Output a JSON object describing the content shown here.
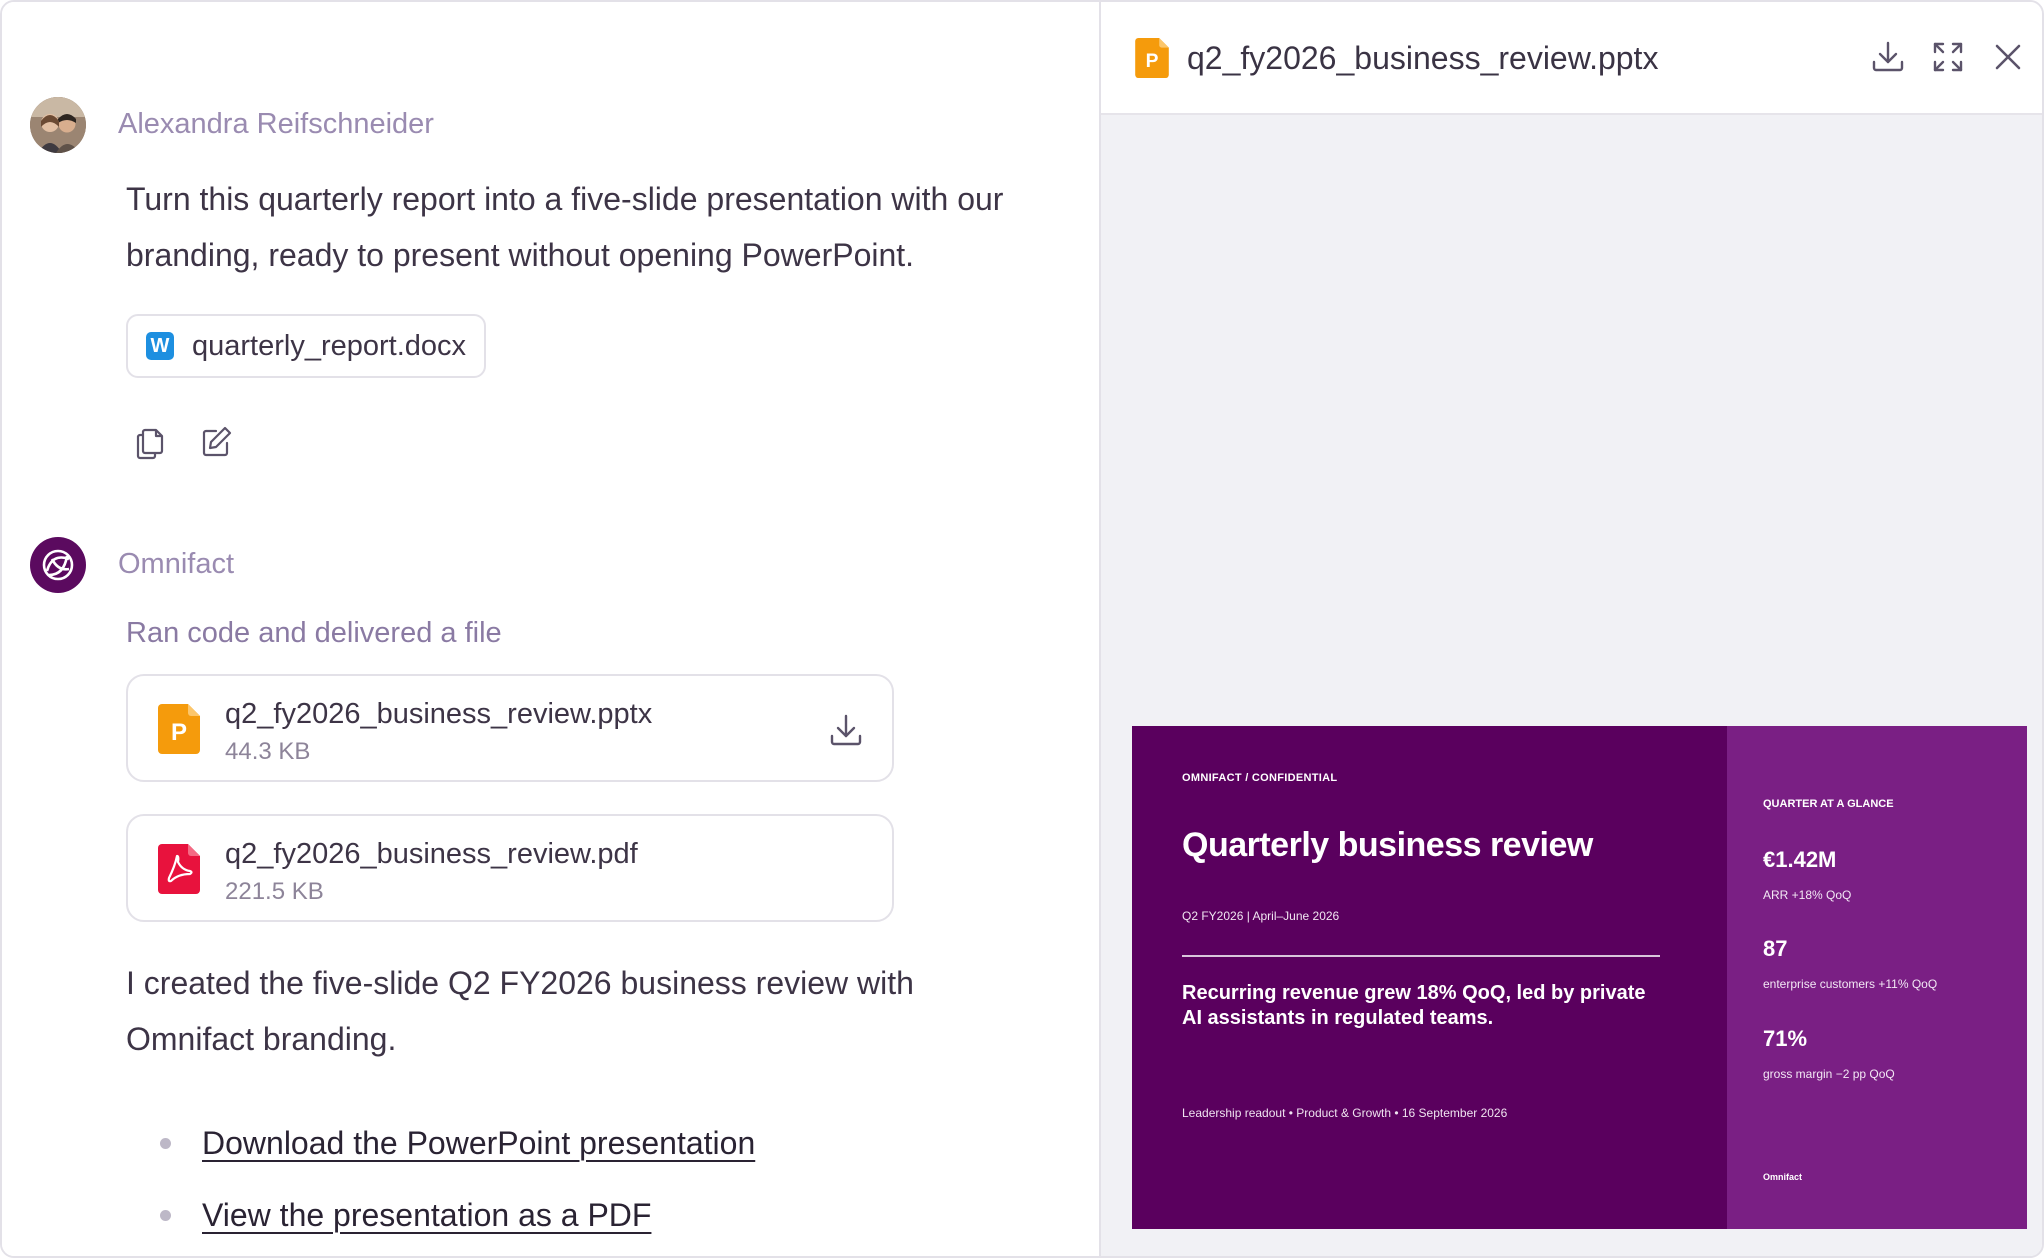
{
  "conversation": {
    "user": {
      "name": "Alexandra Reifschneider",
      "message": "Turn this quarterly report into a five-slide presentation with our branding, ready to present without opening PowerPoint.",
      "attachment": "quarterly_report.docx"
    },
    "assistant": {
      "name": "Omnifact",
      "status": "Ran code and delivered a file",
      "files": [
        {
          "name": "q2_fy2026_business_review.pptx",
          "size": "44.3 KB",
          "type": "pptx"
        },
        {
          "name": "q2_fy2026_business_review.pdf",
          "size": "221.5 KB",
          "type": "pdf"
        }
      ],
      "message": "I created the five-slide Q2 FY2026 business review with Omnifact branding.",
      "links": [
        "Download the PowerPoint presentation",
        "View the presentation as a PDF"
      ]
    }
  },
  "preview": {
    "title": "q2_fy2026_business_review.pptx",
    "slide": {
      "kicker": "OMNIFACT / CONFIDENTIAL",
      "title": "Quarterly business review",
      "subtitle": "Q2 FY2026 | April–June 2026",
      "headline": "Recurring revenue grew 18% QoQ, led by private AI assistants in regulated teams.",
      "footer": "Leadership readout  •  Product & Growth  •  16 September 2026",
      "side_label": "QUARTER AT A GLANCE",
      "kpis": [
        {
          "value": "€1.42M",
          "caption": "ARR  +18% QoQ"
        },
        {
          "value": "87",
          "caption": "enterprise customers  +11% QoQ"
        },
        {
          "value": "71%",
          "caption": "gross margin  −2 pp QoQ"
        }
      ],
      "logo": "Omnifact"
    }
  },
  "colors": {
    "slide_primary": "#5a005e",
    "slide_side": "#7a1f84",
    "author": "#9a8bb1",
    "pptx_orange": "#f59b0c",
    "pdf_red": "#e8123d",
    "word_blue": "#1d8fe0"
  },
  "icons": {
    "copy": "copy-icon",
    "edit": "edit-icon",
    "download": "download-icon",
    "fullscreen": "fullscreen-icon",
    "close": "close-icon"
  }
}
